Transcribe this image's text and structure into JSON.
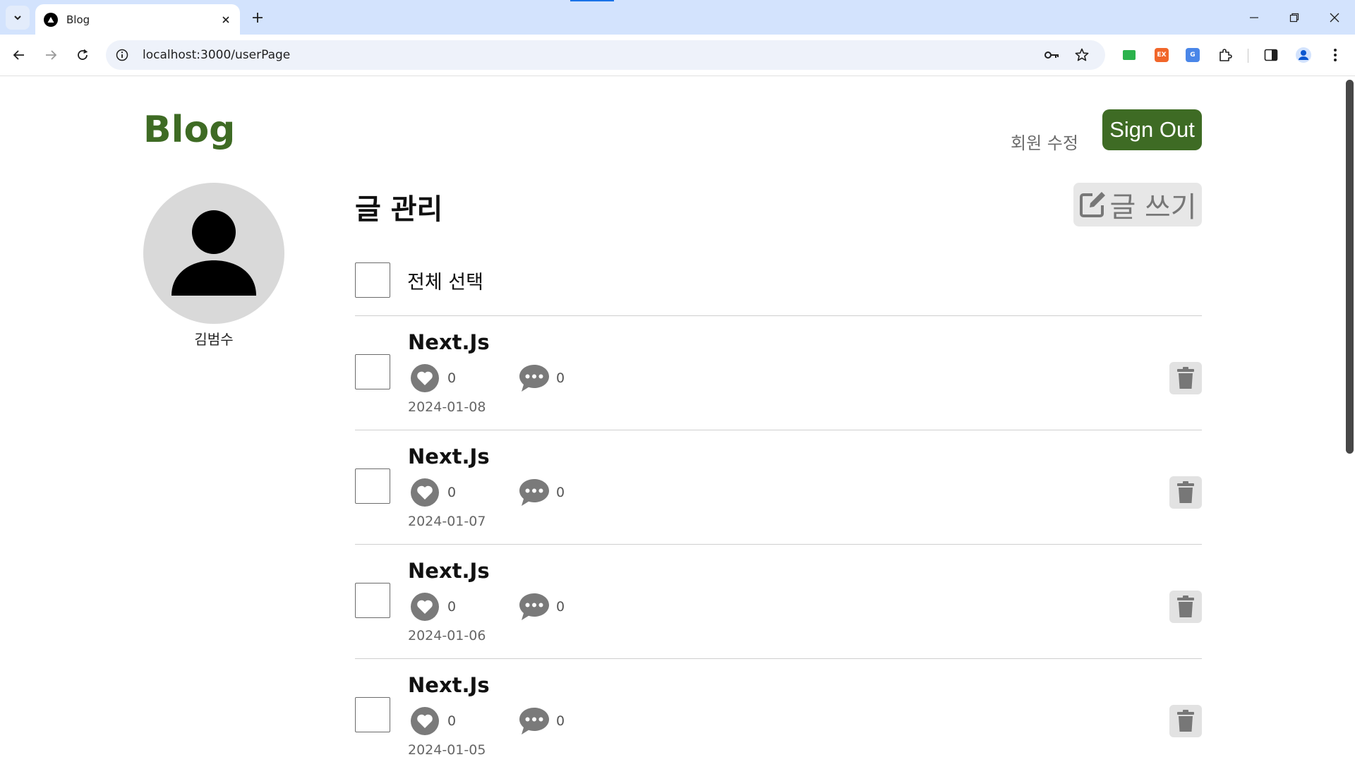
{
  "browser": {
    "tab_title": "Blog",
    "url": "localhost:3000/userPage",
    "extensions": [
      {
        "name": "ext-green",
        "color": "#2bb24c",
        "text": ""
      },
      {
        "name": "ext-orange",
        "color": "#f1662a",
        "text": "EX"
      },
      {
        "name": "ext-translate",
        "color": "#4a86e8",
        "text": "G"
      }
    ]
  },
  "header": {
    "brand": "Blog",
    "edit_profile": "회원 수정",
    "sign_out": "Sign Out",
    "brand_color": "#3e6b24"
  },
  "profile": {
    "name": "김범수"
  },
  "manage": {
    "title": "글 관리",
    "write_label": "글 쓰기",
    "select_all": "전체 선택"
  },
  "posts": [
    {
      "title": "Next.Js",
      "likes": "0",
      "comments": "0",
      "date": "2024-01-08"
    },
    {
      "title": "Next.Js",
      "likes": "0",
      "comments": "0",
      "date": "2024-01-07"
    },
    {
      "title": "Next.Js",
      "likes": "0",
      "comments": "0",
      "date": "2024-01-06"
    },
    {
      "title": "Next.Js",
      "likes": "0",
      "comments": "0",
      "date": "2024-01-05"
    }
  ]
}
